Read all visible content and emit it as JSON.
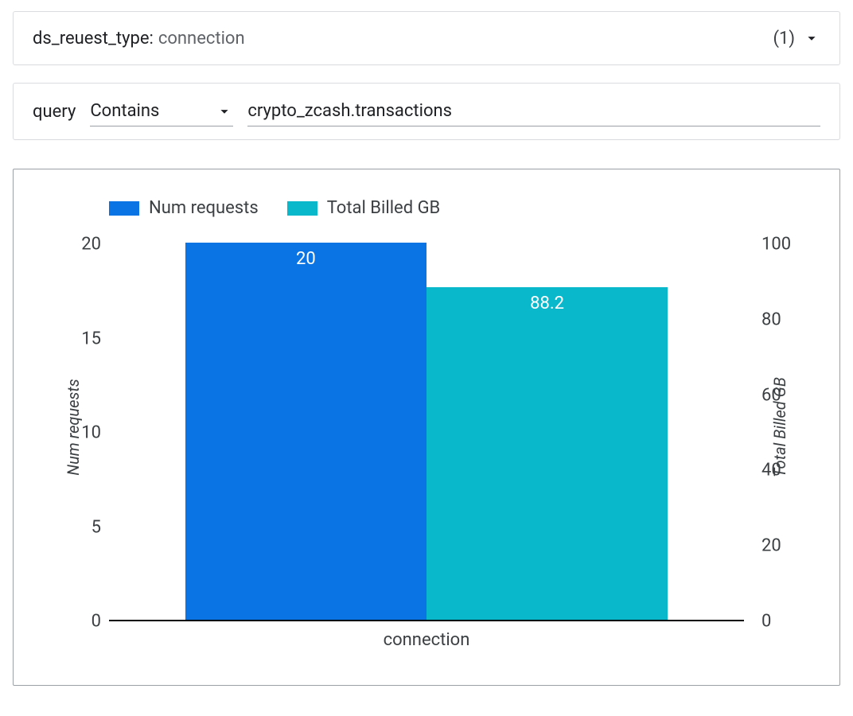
{
  "filter": {
    "key": "ds_reuest_type",
    "value": "connection",
    "count_label": "(1)"
  },
  "query": {
    "label": "query",
    "operator": "Contains",
    "value": "crypto_zcash.transactions"
  },
  "legend": {
    "series1": "Num requests",
    "series2": "Total Billed GB"
  },
  "axes": {
    "y_left_label": "Num requests",
    "y_right_label": "Total Billed GB",
    "x_category": "connection",
    "y_left_ticks": [
      "0",
      "5",
      "10",
      "15",
      "20"
    ],
    "y_right_ticks": [
      "0",
      "20",
      "40",
      "60",
      "80",
      "100"
    ]
  },
  "bars": {
    "series1_value_label": "20",
    "series2_value_label": "88.2"
  },
  "colors": {
    "series1": "#0b74e5",
    "series2": "#0ab8cc"
  },
  "chart_data": {
    "type": "bar",
    "categories": [
      "connection"
    ],
    "series": [
      {
        "name": "Num requests",
        "axis": "left",
        "values": [
          20
        ]
      },
      {
        "name": "Total Billed GB",
        "axis": "right",
        "values": [
          88.2
        ]
      }
    ],
    "y_left": {
      "label": "Num requests",
      "range": [
        0,
        20
      ],
      "ticks": [
        0,
        5,
        10,
        15,
        20
      ]
    },
    "y_right": {
      "label": "Total Billed GB",
      "range": [
        0,
        100
      ],
      "ticks": [
        0,
        20,
        40,
        60,
        80,
        100
      ]
    },
    "xlabel": "",
    "title": ""
  }
}
